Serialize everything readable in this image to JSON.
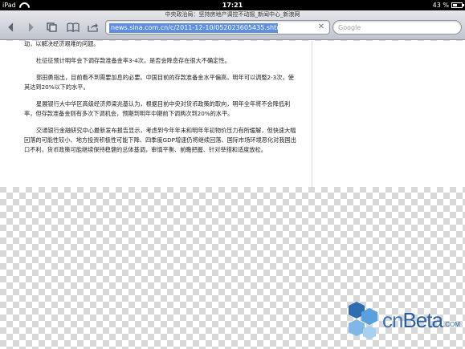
{
  "status_bar": {
    "device": "iPad",
    "time": "17:21",
    "battery_text": "43 %",
    "battery_level": 0.43
  },
  "browser": {
    "page_title": "中央政治局：坚持房地产调控不动摇_新闻中心_新浪网",
    "address": "news.sina.com.cn/c/2011-12-10/052023605435.shtml",
    "search_placeholder": "Google",
    "icons": {
      "back": "back-arrow-icon",
      "forward": "forward-arrow-icon",
      "pages": "pages-icon",
      "bookmarks": "bookmarks-icon",
      "share": "share-icon",
      "clear": "clear-icon"
    }
  },
  "article": {
    "paragraphs": [
      "动，以解决经济艰难的问题。",
      "杜征征预计明年会下调存款准备金率3-4次，是否会降息存在很大不确定性。",
      "郭田勇指出，目前看不到需要加息的必要。中国目前的存款准备金水平偏高，明年可以调整2-3次，使其达到20%以下的水平。",
      "星展银行大中华区高级经济师梁兆基认为，根据目前中央对货币政策的取向，明年全年将不会降低利率，但存款准备金则有多次下调机会，预期到明年中期前下调两次到20%的水平。",
      "交通银行金融研究中心最新发布报告显示，考虑到今年年末和明年年初物价压力有所缓解，但快速大幅回落的可能性较小、地方投资积极性可能下降、四季度GDP增速仍将继续回落、国际市场环境恶化对我国出口不利，货币政策可能继续保持稳健的总体基调，审慎平衡、前瞻把握、针对举措和适度放松。"
    ]
  },
  "watermark": {
    "logo_text_cn": "cn",
    "logo_text_beta": "Beta",
    "logo_dotcom": ".COM"
  }
}
